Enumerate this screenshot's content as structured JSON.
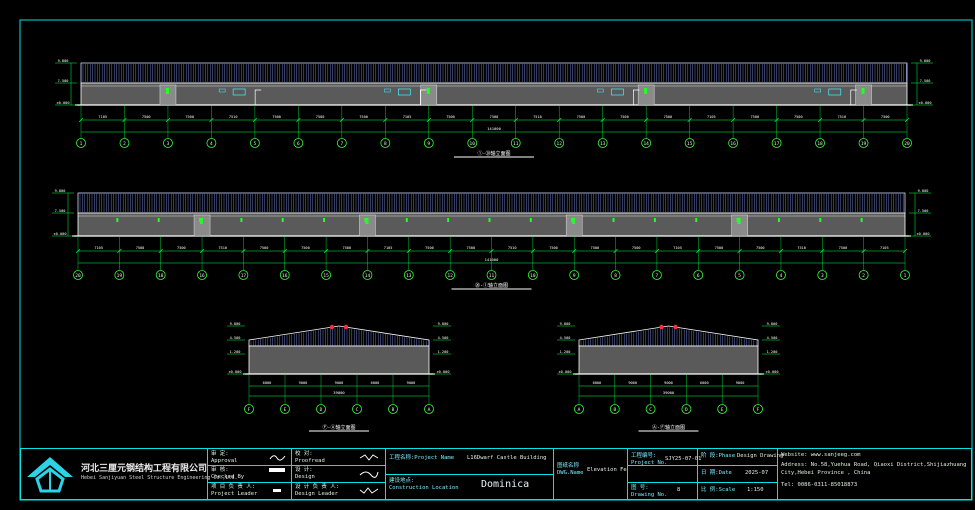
{
  "drawing": {
    "elevation_a": {
      "axes": [
        "1",
        "2",
        "3",
        "4",
        "5",
        "6",
        "7",
        "8",
        "9",
        "10",
        "11",
        "12",
        "13",
        "14",
        "15",
        "16",
        "17",
        "18",
        "19",
        "20"
      ],
      "bay_dims": [
        "7105",
        "7500",
        "7500",
        "7510",
        "7500",
        "7500",
        "7500",
        "7105",
        "7500",
        "7500",
        "7510",
        "7500",
        "7500",
        "7500",
        "7105",
        "7500",
        "7500",
        "7510",
        "7500"
      ],
      "total_dim": "141000",
      "title": "①-⑳轴立面图"
    },
    "elevation_b": {
      "axes": [
        "20",
        "19",
        "18",
        "16",
        "17",
        "16",
        "15",
        "14",
        "13",
        "12",
        "11",
        "10",
        "9",
        "8",
        "7",
        "6",
        "5",
        "4",
        "3",
        "2",
        "1"
      ],
      "bay_dims": [
        "7105",
        "7500",
        "7500",
        "7510",
        "7500",
        "7500",
        "7500",
        "7105",
        "7500",
        "7500",
        "7510",
        "7500",
        "7500",
        "7500",
        "7105",
        "7500",
        "7500",
        "7510",
        "7500",
        "7105"
      ],
      "total_dim": "141000",
      "title": "⑳-①轴立面图"
    },
    "gable_left": {
      "axes": [
        "F",
        "E",
        "D",
        "C",
        "B",
        "A"
      ],
      "dims": [
        "6000",
        "9000",
        "9000",
        "6000",
        "9000"
      ],
      "total_dim": "39000",
      "title": "Ⓕ-Ⓐ轴立面图"
    },
    "gable_right": {
      "axes": [
        "A",
        "B",
        "C",
        "D",
        "E",
        "F"
      ],
      "dims": [
        "6000",
        "9000",
        "9000",
        "6000",
        "9000"
      ],
      "total_dim": "39000",
      "title": "Ⓐ-Ⓕ轴立面图"
    },
    "levels": [
      "9.800",
      "7.500",
      "±0.000",
      "4.500",
      "1.200"
    ]
  },
  "title_block": {
    "company_cn": "河北三厘元钢结构工程有限公司",
    "company_en": "Hebei Sanjiyuan Steel Structure Engineering Co.,Ltd.",
    "approval_label_cn": "审    定:",
    "approval_label_en": "Approval",
    "checked_label_cn": "审    核:",
    "checked_label_en": "Checked By",
    "leader_label_cn": "项 目 负 责 人:",
    "leader_label_en": "Project   Leader",
    "proofread_label_cn": "校    对:",
    "proofread_label_en": "Proofread",
    "design_label_cn": "设    计:",
    "design_label_en": "Design",
    "design_leader_cn": "设 计 负 责 人:",
    "design_leader_en": "Design  Leader",
    "project_name_label": "工程名称:Project Name",
    "project_name_value": "L16Dwarf Castle Building",
    "location_label_cn": "建设地点:",
    "location_label_en": "Construction Location",
    "location_value": "Dominica",
    "dwg_name_label_cn": "图纸名称",
    "dwg_name_label_en": "DWG.Name",
    "dwg_name_value": "Elevation Fe",
    "project_no_label_cn": "工程编号:",
    "project_no_label_en": "Project No.",
    "project_no_value": "SJY25-07-01",
    "drawing_no_label_cn": "图    号:",
    "drawing_no_label_en": "Drawing No.",
    "drawing_no_value": "8",
    "phase_label": "阶 段:Phase",
    "phase_value": "Design Drawing",
    "date_label": "日 期:Date",
    "date_value": "2025-07",
    "scale_label": "比 例:Scale",
    "scale_value": "1:150",
    "website": "Website: www.sanjeeg.com",
    "address1": "Address: No.58,Yuehua Road, Qiaoxi District,Shijiazhuang",
    "address2": "City,Hebei Province , China",
    "tel": "Tel:  0086-0311-85018873"
  },
  "colors": {
    "frame": "#00e5e5",
    "wall": "#ffffff",
    "dim": "#00ff44",
    "marker": "#ff3030",
    "axis": "#33ff33"
  }
}
